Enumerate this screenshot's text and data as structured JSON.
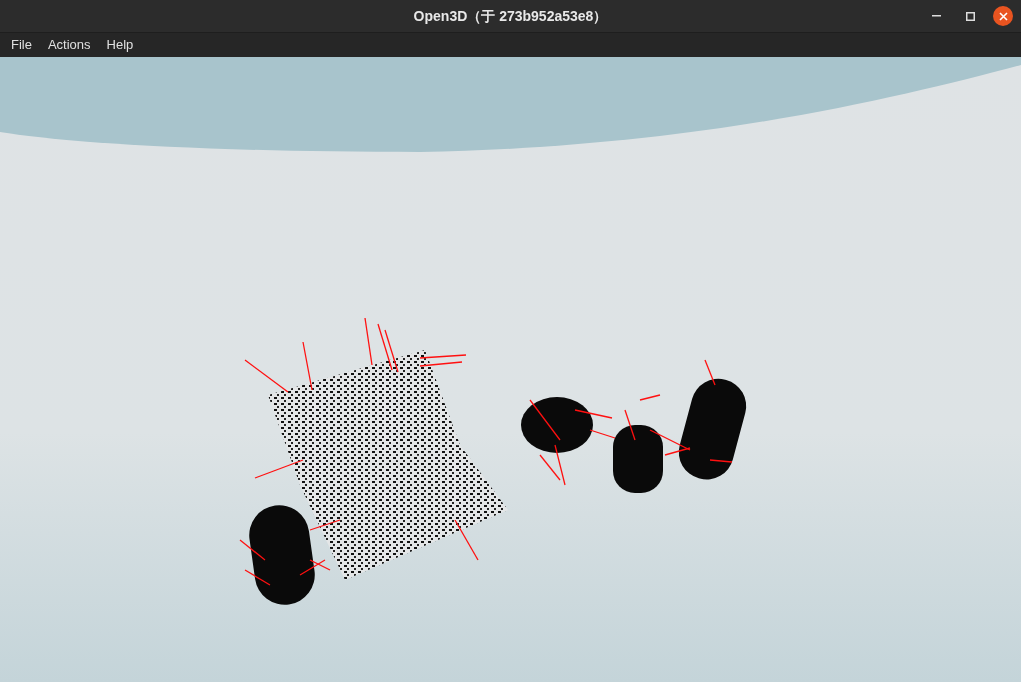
{
  "window": {
    "title": "Open3D（于 273b952a53e8）"
  },
  "menu": [
    "File",
    "Actions",
    "Help"
  ]
}
